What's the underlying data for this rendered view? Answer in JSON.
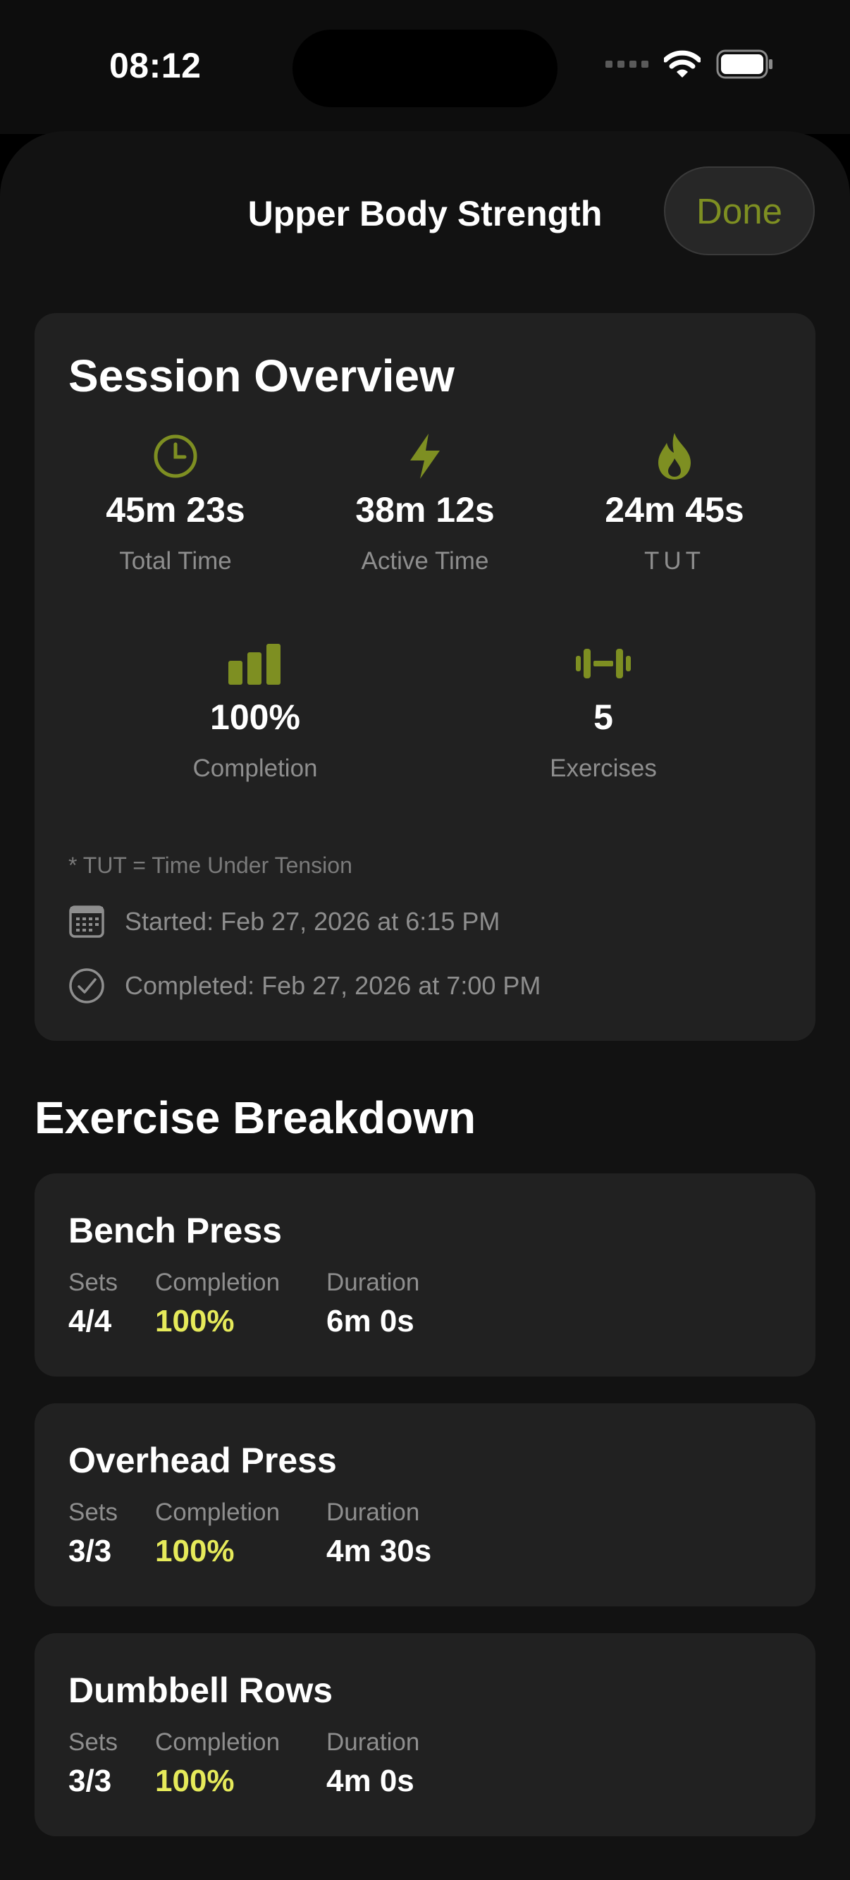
{
  "status_bar": {
    "time": "08:12"
  },
  "header": {
    "title": "Upper Body Strength",
    "done_label": "Done"
  },
  "overview": {
    "title": "Session Overview",
    "stats": [
      {
        "icon": "clock-icon",
        "value": "45m 23s",
        "label": "Total Time"
      },
      {
        "icon": "bolt-icon",
        "value": "38m 12s",
        "label": "Active Time"
      },
      {
        "icon": "flame-icon",
        "value": "24m 45s",
        "label": "TUT"
      },
      {
        "icon": "bar-chart-icon",
        "value": "100%",
        "label": "Completion"
      },
      {
        "icon": "dumbbell-icon",
        "value": "5",
        "label": "Exercises"
      }
    ],
    "note": "* TUT = Time Under Tension",
    "started": "Started: Feb 27, 2026 at 6:15 PM",
    "completed": "Completed: Feb 27, 2026 at 7:00 PM"
  },
  "breakdown": {
    "title": "Exercise Breakdown",
    "headers": {
      "sets": "Sets",
      "completion": "Completion",
      "duration": "Duration"
    },
    "exercises": [
      {
        "name": "Bench Press",
        "sets": "4/4",
        "completion": "100%",
        "duration": "6m 0s"
      },
      {
        "name": "Overhead Press",
        "sets": "3/3",
        "completion": "100%",
        "duration": "4m 30s"
      },
      {
        "name": "Dumbbell Rows",
        "sets": "3/3",
        "completion": "100%",
        "duration": "4m 0s"
      }
    ]
  },
  "colors": {
    "accent": "#7e8f22",
    "highlight": "#e6ea5a",
    "card": "#212121",
    "background": "#121212"
  }
}
